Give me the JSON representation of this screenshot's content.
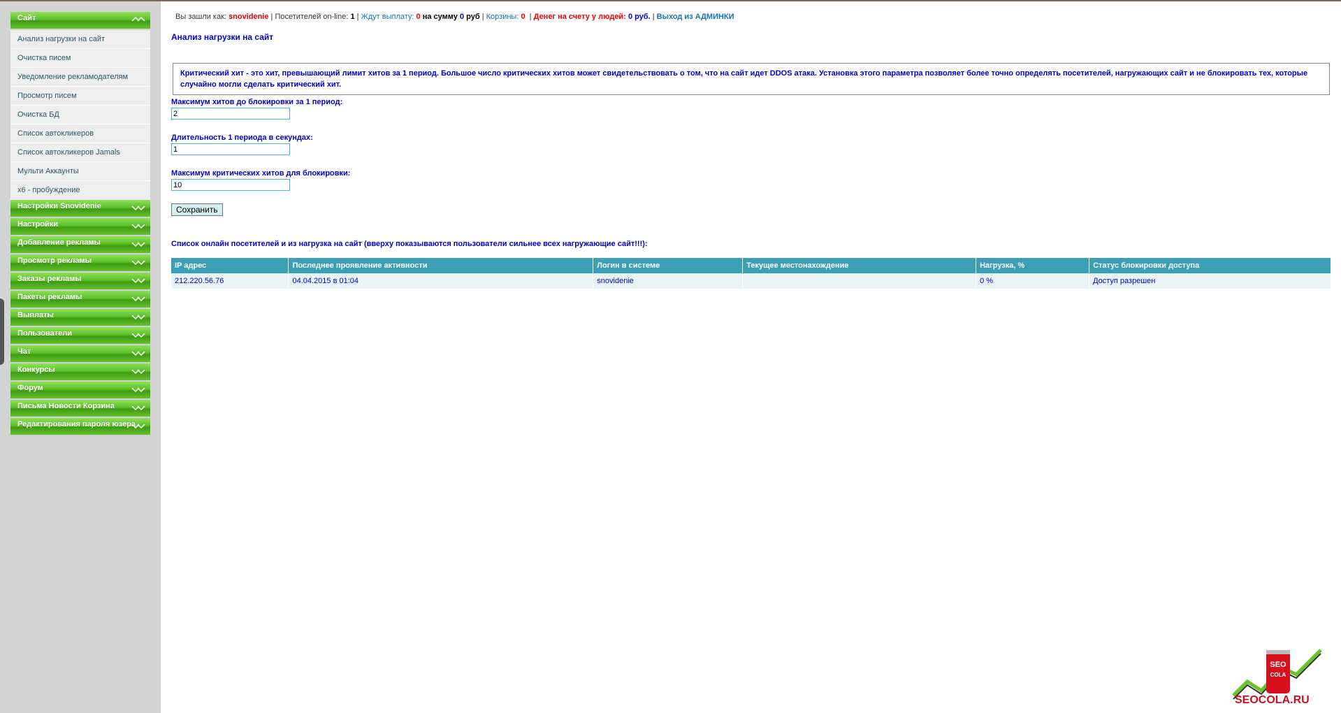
{
  "sidebar": {
    "open_category": "Сайт",
    "sub_items": [
      "Анализ нагрузки на сайт",
      "Очистка писем",
      "Уведомление рекламодателям",
      "Просмотр писем",
      "Очистка БД",
      "Список автокликеров",
      "Список автокликеров Jamals",
      "Мульти Аккаунты",
      "x6 - пробуждение"
    ],
    "categories": [
      "Настройки Snovidenie",
      "Настройки",
      "Добавление рекламы",
      "Просмотр рекламы",
      "Заказы рекламы",
      "Пакеты рекламы",
      "Выплаты",
      "Пользователи",
      "Чат",
      "Конкурсы",
      "Форум",
      "Письма Новости Корзина",
      "Редактирования пароля юзера"
    ]
  },
  "status_bar": {
    "logged_as_label": "Вы зашли как:",
    "username": "snovidenie",
    "online_label": "Посетителей on-line:",
    "online_count": "1",
    "await_payout_label": "Ждут выплату:",
    "await_payout_count": "0",
    "sum_label": "на сумму",
    "sum_value": "0",
    "sum_unit": "руб",
    "carts_label": "Корзины:",
    "carts_count": "0",
    "money_label": "Денег на счету у людей:",
    "money_value": "0 руб.",
    "exit_label": "Выход из АДМИНКИ"
  },
  "page_title": "Анализ нагрузки на сайт",
  "info_text": "Критический хит - это хит, превышающий лимит хитов за 1 период. Большое число критических хитов может свидетельствовать о том, что на сайт идет DDOS атака. Установка этого параметра позволяет более точно определять посетителей, нагружающих сайт и не блокировать тех, которые случайно могли сделать критический хит.",
  "form": {
    "max_hits_label": "Максимум хитов до блокировки за 1 период:",
    "max_hits_value": "2",
    "period_label": "Длительность 1 периода в секундах:",
    "period_value": "1",
    "max_critical_label": "Максимум критических хитов для блокировки:",
    "max_critical_value": "10",
    "save_label": "Сохранить"
  },
  "list_title": "Список онлайн посетителей и из нагрузка на сайт (вверху показываются пользователи сильнее всех нагружающие сайт!!!):",
  "table": {
    "headers": [
      "IP адрес",
      "Последнее проявление активности",
      "Логин в системе",
      "Текущее местонахождение",
      "Нагрузка, %",
      "Статус блокировки доступа"
    ],
    "rows": [
      [
        "212.220.56.76",
        "04.04.2015 в 01:04",
        "snovidenie",
        "",
        "0 %",
        "Доступ разрешен"
      ]
    ]
  },
  "logo": {
    "can_text_1": "SEO",
    "can_text_2": "COLA",
    "site": "SEOCOLA.RU"
  }
}
